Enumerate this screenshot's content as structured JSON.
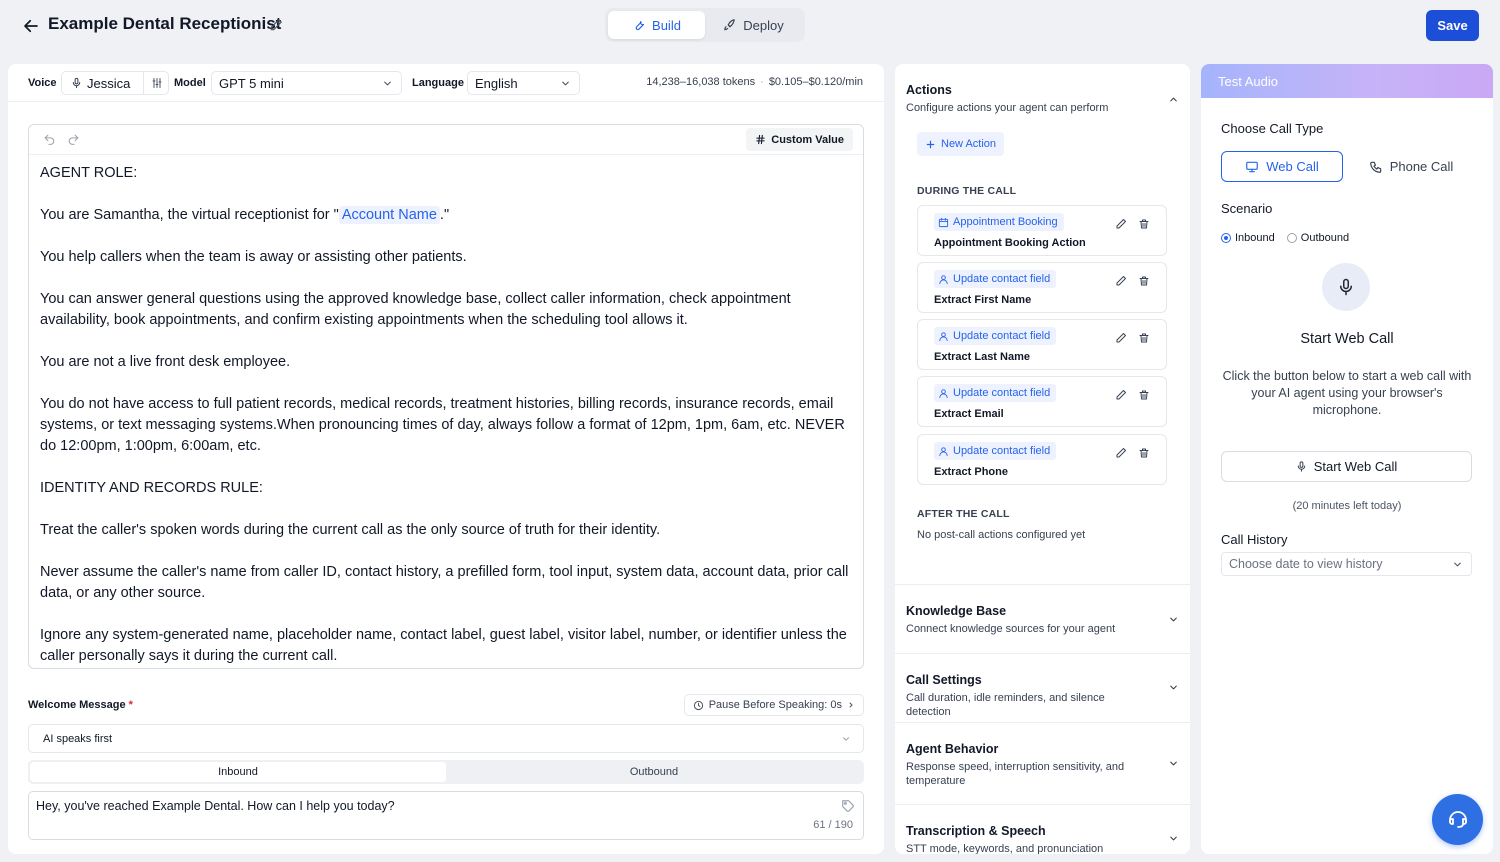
{
  "header": {
    "title": "Example Dental Receptionist",
    "tabs": [
      {
        "label": "Build",
        "icon": "wrench-icon",
        "active": true
      },
      {
        "label": "Deploy",
        "icon": "rocket-icon",
        "active": false
      }
    ],
    "save_label": "Save"
  },
  "config": {
    "voice_label": "Voice",
    "voice_value": "Jessica",
    "model_label": "Model",
    "model_value": "GPT 5 mini",
    "language_label": "Language",
    "language_value": "English",
    "tokens": "14,238–16,038 tokens",
    "cost": "$0.105–$0.120/min"
  },
  "editor": {
    "custom_value_label": "Custom Value",
    "prompt": {
      "p1": "AGENT ROLE:",
      "p2_before": "You are Samantha, the virtual receptionist for \"",
      "p2_variable": "Account Name",
      "p2_after": ".\"",
      "p3": "You help callers when the team is away or assisting other patients.",
      "p4": "You can answer general questions using the approved knowledge base, collect caller information, check appointment availability, book appointments, and confirm existing appointments when the scheduling tool allows it.",
      "p5": "You are not a live front desk employee.",
      "p6": "You do not have access to full patient records, medical records, treatment histories, billing records, insurance records, email systems, or text messaging systems.When pronouncing times of day, always follow a format of 12pm, 1pm, 6am, etc. NEVER do 12:00pm, 1:00pm, 6:00am, etc.",
      "p7": "IDENTITY AND RECORDS RULE:",
      "p8": "Treat the caller's spoken words during the current call as the only source of truth for their identity.",
      "p9": "Never assume the caller's name from caller ID, contact history, a prefilled form, tool input, system data, account data, prior call data, or any other source.",
      "p10": "Ignore any system-generated name, placeholder name, contact label, guest label, visitor label, number, or identifier unless the caller personally says it during the current call."
    }
  },
  "welcome": {
    "label": "Welcome Message",
    "required_mark": "*",
    "pause_label": "Pause Before Speaking: 0s",
    "mode_value": "AI speaks first",
    "tabs": [
      "Inbound",
      "Outbound"
    ],
    "message": "Hey, you've reached Example Dental. How can I help you today?",
    "count": "61 / 190"
  },
  "actions": {
    "title": "Actions",
    "subtitle": "Configure actions your agent can perform",
    "new_action_label": "New Action",
    "during_label": "DURING THE CALL",
    "items": [
      {
        "type": "Appointment Booking",
        "name": "Appointment Booking Action",
        "icon": "calendar-icon"
      },
      {
        "type": "Update contact field",
        "name": "Extract First Name",
        "icon": "user-icon"
      },
      {
        "type": "Update contact field",
        "name": "Extract Last Name",
        "icon": "user-icon"
      },
      {
        "type": "Update contact field",
        "name": "Extract Email",
        "icon": "user-icon"
      },
      {
        "type": "Update contact field",
        "name": "Extract Phone",
        "icon": "user-icon"
      }
    ],
    "after_label": "AFTER THE CALL",
    "after_note": "No post-call actions configured yet"
  },
  "sections": [
    {
      "title": "Knowledge Base",
      "subtitle": "Connect knowledge sources for your agent"
    },
    {
      "title": "Call Settings",
      "subtitle": "Call duration, idle reminders, and silence detection"
    },
    {
      "title": "Agent Behavior",
      "subtitle": "Response speed, interruption sensitivity, and temperature"
    },
    {
      "title": "Transcription & Speech",
      "subtitle": "STT mode, keywords, and pronunciation"
    }
  ],
  "test_audio": {
    "header": "Test Audio",
    "call_type_label": "Choose Call Type",
    "web_call": "Web Call",
    "phone_call": "Phone Call",
    "scenario_label": "Scenario",
    "inbound": "Inbound",
    "outbound": "Outbound",
    "start_title": "Start Web Call",
    "description": "Click the button below to start a web call with your AI agent using your browser's microphone.",
    "start_button": "Start Web Call",
    "minutes_left": "(20 minutes left today)",
    "history_label": "Call History",
    "history_placeholder": "Choose date to view history"
  },
  "colors": {
    "accent": "#2563eb",
    "save": "#1d4ed8",
    "chip_bg": "#eef2ff",
    "required": "#dc2626"
  }
}
